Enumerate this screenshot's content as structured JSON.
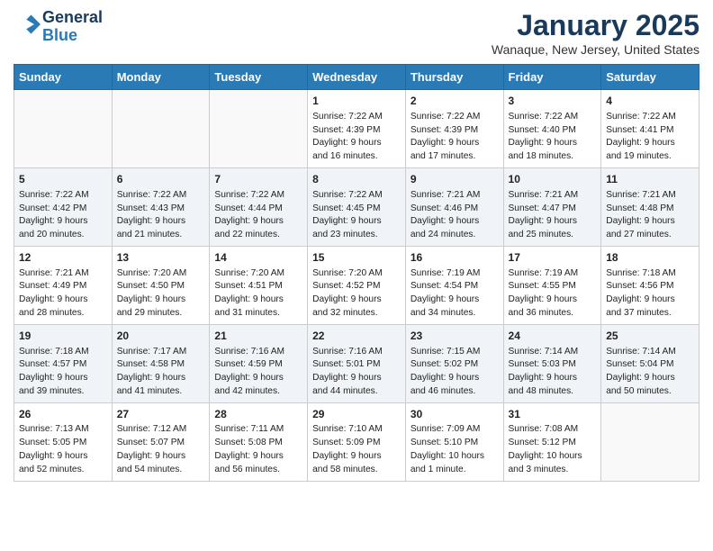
{
  "header": {
    "logo_line1": "General",
    "logo_line2": "Blue",
    "month": "January 2025",
    "location": "Wanaque, New Jersey, United States"
  },
  "weekdays": [
    "Sunday",
    "Monday",
    "Tuesday",
    "Wednesday",
    "Thursday",
    "Friday",
    "Saturday"
  ],
  "weeks": [
    [
      {
        "day": "",
        "info": ""
      },
      {
        "day": "",
        "info": ""
      },
      {
        "day": "",
        "info": ""
      },
      {
        "day": "1",
        "info": "Sunrise: 7:22 AM\nSunset: 4:39 PM\nDaylight: 9 hours\nand 16 minutes."
      },
      {
        "day": "2",
        "info": "Sunrise: 7:22 AM\nSunset: 4:39 PM\nDaylight: 9 hours\nand 17 minutes."
      },
      {
        "day": "3",
        "info": "Sunrise: 7:22 AM\nSunset: 4:40 PM\nDaylight: 9 hours\nand 18 minutes."
      },
      {
        "day": "4",
        "info": "Sunrise: 7:22 AM\nSunset: 4:41 PM\nDaylight: 9 hours\nand 19 minutes."
      }
    ],
    [
      {
        "day": "5",
        "info": "Sunrise: 7:22 AM\nSunset: 4:42 PM\nDaylight: 9 hours\nand 20 minutes."
      },
      {
        "day": "6",
        "info": "Sunrise: 7:22 AM\nSunset: 4:43 PM\nDaylight: 9 hours\nand 21 minutes."
      },
      {
        "day": "7",
        "info": "Sunrise: 7:22 AM\nSunset: 4:44 PM\nDaylight: 9 hours\nand 22 minutes."
      },
      {
        "day": "8",
        "info": "Sunrise: 7:22 AM\nSunset: 4:45 PM\nDaylight: 9 hours\nand 23 minutes."
      },
      {
        "day": "9",
        "info": "Sunrise: 7:21 AM\nSunset: 4:46 PM\nDaylight: 9 hours\nand 24 minutes."
      },
      {
        "day": "10",
        "info": "Sunrise: 7:21 AM\nSunset: 4:47 PM\nDaylight: 9 hours\nand 25 minutes."
      },
      {
        "day": "11",
        "info": "Sunrise: 7:21 AM\nSunset: 4:48 PM\nDaylight: 9 hours\nand 27 minutes."
      }
    ],
    [
      {
        "day": "12",
        "info": "Sunrise: 7:21 AM\nSunset: 4:49 PM\nDaylight: 9 hours\nand 28 minutes."
      },
      {
        "day": "13",
        "info": "Sunrise: 7:20 AM\nSunset: 4:50 PM\nDaylight: 9 hours\nand 29 minutes."
      },
      {
        "day": "14",
        "info": "Sunrise: 7:20 AM\nSunset: 4:51 PM\nDaylight: 9 hours\nand 31 minutes."
      },
      {
        "day": "15",
        "info": "Sunrise: 7:20 AM\nSunset: 4:52 PM\nDaylight: 9 hours\nand 32 minutes."
      },
      {
        "day": "16",
        "info": "Sunrise: 7:19 AM\nSunset: 4:54 PM\nDaylight: 9 hours\nand 34 minutes."
      },
      {
        "day": "17",
        "info": "Sunrise: 7:19 AM\nSunset: 4:55 PM\nDaylight: 9 hours\nand 36 minutes."
      },
      {
        "day": "18",
        "info": "Sunrise: 7:18 AM\nSunset: 4:56 PM\nDaylight: 9 hours\nand 37 minutes."
      }
    ],
    [
      {
        "day": "19",
        "info": "Sunrise: 7:18 AM\nSunset: 4:57 PM\nDaylight: 9 hours\nand 39 minutes."
      },
      {
        "day": "20",
        "info": "Sunrise: 7:17 AM\nSunset: 4:58 PM\nDaylight: 9 hours\nand 41 minutes."
      },
      {
        "day": "21",
        "info": "Sunrise: 7:16 AM\nSunset: 4:59 PM\nDaylight: 9 hours\nand 42 minutes."
      },
      {
        "day": "22",
        "info": "Sunrise: 7:16 AM\nSunset: 5:01 PM\nDaylight: 9 hours\nand 44 minutes."
      },
      {
        "day": "23",
        "info": "Sunrise: 7:15 AM\nSunset: 5:02 PM\nDaylight: 9 hours\nand 46 minutes."
      },
      {
        "day": "24",
        "info": "Sunrise: 7:14 AM\nSunset: 5:03 PM\nDaylight: 9 hours\nand 48 minutes."
      },
      {
        "day": "25",
        "info": "Sunrise: 7:14 AM\nSunset: 5:04 PM\nDaylight: 9 hours\nand 50 minutes."
      }
    ],
    [
      {
        "day": "26",
        "info": "Sunrise: 7:13 AM\nSunset: 5:05 PM\nDaylight: 9 hours\nand 52 minutes."
      },
      {
        "day": "27",
        "info": "Sunrise: 7:12 AM\nSunset: 5:07 PM\nDaylight: 9 hours\nand 54 minutes."
      },
      {
        "day": "28",
        "info": "Sunrise: 7:11 AM\nSunset: 5:08 PM\nDaylight: 9 hours\nand 56 minutes."
      },
      {
        "day": "29",
        "info": "Sunrise: 7:10 AM\nSunset: 5:09 PM\nDaylight: 9 hours\nand 58 minutes."
      },
      {
        "day": "30",
        "info": "Sunrise: 7:09 AM\nSunset: 5:10 PM\nDaylight: 10 hours\nand 1 minute."
      },
      {
        "day": "31",
        "info": "Sunrise: 7:08 AM\nSunset: 5:12 PM\nDaylight: 10 hours\nand 3 minutes."
      },
      {
        "day": "",
        "info": ""
      }
    ]
  ]
}
